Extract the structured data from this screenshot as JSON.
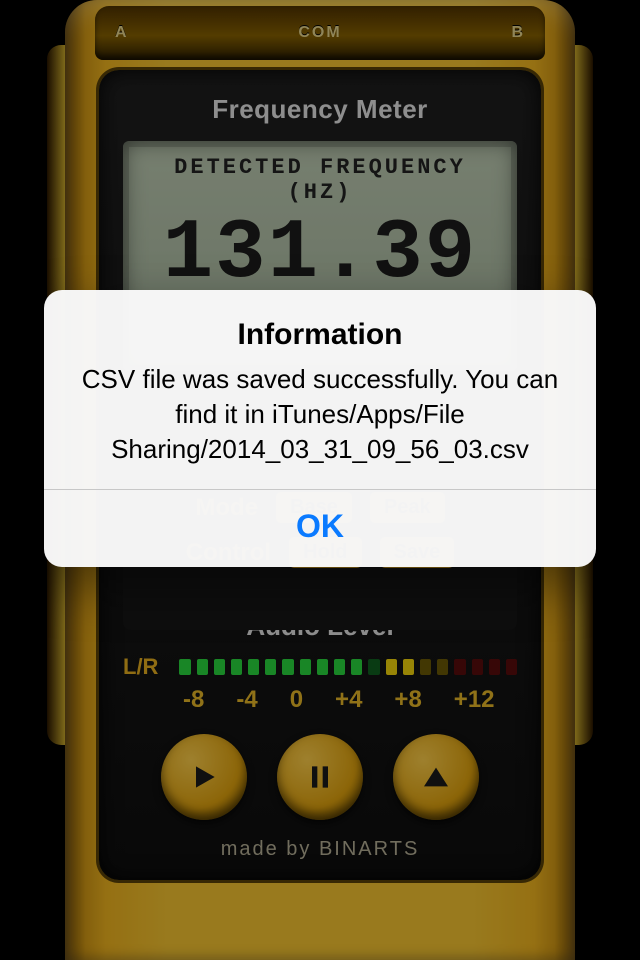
{
  "top_ports": {
    "a": "A",
    "com": "COM",
    "b": "B"
  },
  "app_title": "Frequency Meter",
  "lcd": {
    "label": "DETECTED FREQUENCY (HZ)",
    "value": "131.39"
  },
  "mid": {
    "mode_label": "Mode",
    "mode_opts": [
      "Base",
      "Peak"
    ],
    "control_label": "Control",
    "control_opts": [
      "Hold",
      "Save"
    ]
  },
  "audio": {
    "title": "Audio Level",
    "lr": "L/R",
    "scale": [
      "-8",
      "-4",
      "0",
      "+4",
      "+8",
      "+12"
    ]
  },
  "credit": "made by BINARTS",
  "alert": {
    "title": "Information",
    "message": "CSV file was saved successfully. You can find it in iTunes/Apps/File Sharing/2014_03_31_09_56_03.csv",
    "ok": "OK"
  },
  "colors": {
    "accent": "#f7c531",
    "alert_ok": "#0a7aff"
  }
}
